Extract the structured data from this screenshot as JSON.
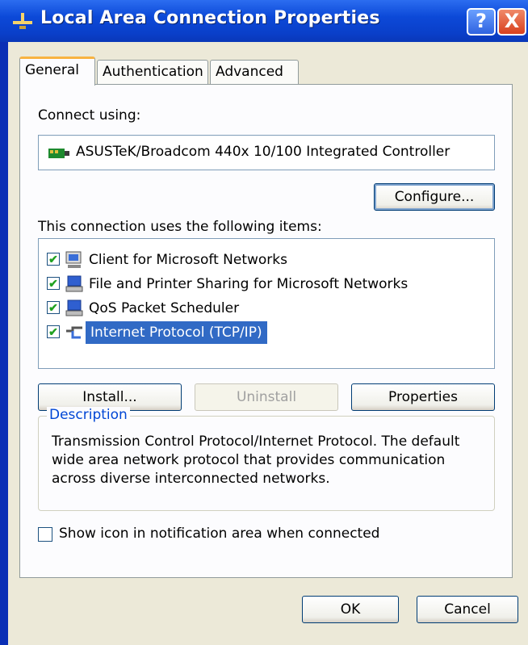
{
  "window": {
    "title": "Local Area Connection Properties",
    "help_label": "?",
    "close_label": "X"
  },
  "tabs": [
    {
      "label": "General",
      "active": true
    },
    {
      "label": "Authentication",
      "active": false
    },
    {
      "label": "Advanced",
      "active": false
    }
  ],
  "general": {
    "connect_using_label": "Connect using:",
    "adapter_name": "ASUSTeK/Broadcom 440x 10/100 Integrated Controller",
    "configure_button": "Configure...",
    "items_label": "This connection uses the following items:",
    "items": [
      {
        "label": "Client for Microsoft Networks",
        "checked": true,
        "icon": "network-client-icon"
      },
      {
        "label": "File and Printer Sharing for Microsoft Networks",
        "checked": true,
        "icon": "network-service-icon"
      },
      {
        "label": "QoS Packet Scheduler",
        "checked": true,
        "icon": "network-service-icon"
      },
      {
        "label": "Internet Protocol (TCP/IP)",
        "checked": true,
        "icon": "protocol-icon",
        "selected": true
      }
    ],
    "install_button": "Install...",
    "uninstall_button": "Uninstall",
    "properties_button": "Properties",
    "description_title": "Description",
    "description_text": "Transmission Control Protocol/Internet Protocol. The default wide area network protocol that provides communication across diverse interconnected networks.",
    "show_icon_label": "Show icon in notification area when connected",
    "show_icon_checked": false
  },
  "footer": {
    "ok_button": "OK",
    "cancel_button": "Cancel"
  },
  "colors": {
    "titlebar": "#0a3fc9",
    "dialog_bg": "#ece9d8",
    "selection": "#316ac5",
    "group_title": "#0046d5"
  }
}
